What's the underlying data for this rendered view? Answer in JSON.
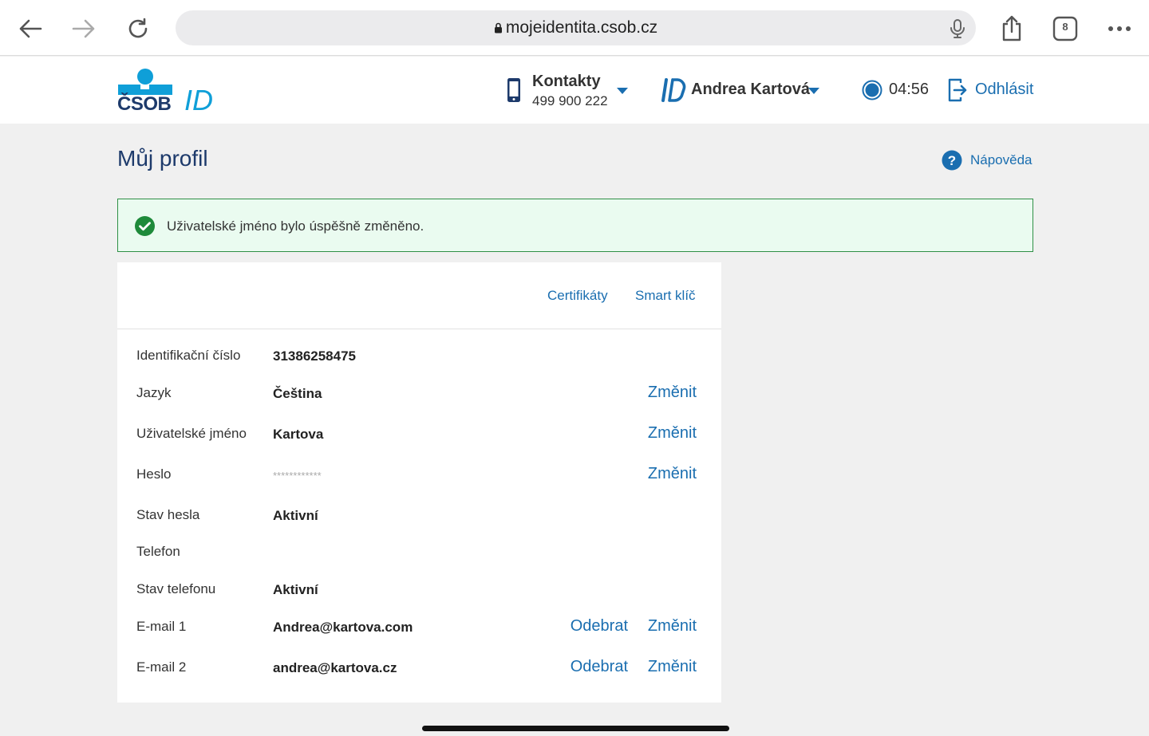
{
  "browser": {
    "url": "mojeidentita.csob.cz",
    "tab_count": "8"
  },
  "header": {
    "logo_brand": "ČSOB",
    "logo_id": "ID",
    "contacts_label": "Kontakty",
    "contacts_phone": "499 900 222",
    "user_name": "Andrea Kartová",
    "timer": "04:56",
    "logout_label": "Odhlásit"
  },
  "page": {
    "title": "Můj profil",
    "help_label": "Nápověda"
  },
  "alert": {
    "message": "Uživatelské jméno bylo úspěšně změněno."
  },
  "tabs": [
    "Certifikáty",
    "Smart klíč"
  ],
  "actions": {
    "change": "Změnit",
    "remove": "Odebrat"
  },
  "profile": {
    "id_label": "Identifikační číslo",
    "id_value": "31386258475",
    "language_label": "Jazyk",
    "language_value": "Čeština",
    "username_label": "Uživatelské jméno",
    "username_value": "Kartova",
    "password_label": "Heslo",
    "password_value": "************",
    "password_status_label": "Stav hesla",
    "password_status_value": "Aktivní",
    "phone_label": "Telefon",
    "phone_value": "",
    "phone_status_label": "Stav telefonu",
    "phone_status_value": "Aktivní",
    "email1_label": "E-mail 1",
    "email1_value": "Andrea@kartova.com",
    "email2_label": "E-mail 2",
    "email2_value": "andrea@kartova.cz"
  },
  "colors": {
    "brand_blue": "#1d3a6b",
    "link_blue": "#1a6eb0",
    "logo_cyan": "#0f9fd8",
    "success_green": "#2f8f46"
  }
}
